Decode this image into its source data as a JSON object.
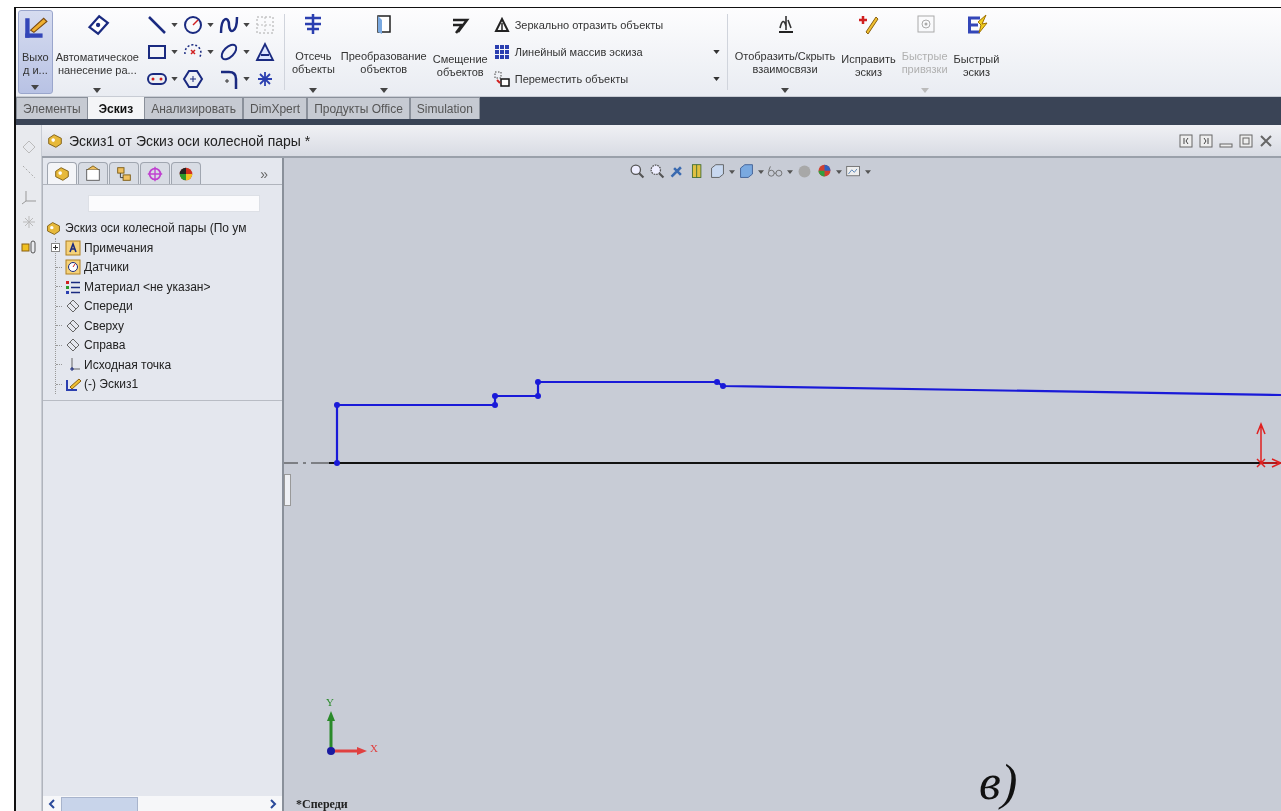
{
  "ribbon": {
    "left_buttons": [
      {
        "label_lines": [
          "Выхо",
          "д и..."
        ],
        "dropdown": true,
        "selected": true
      },
      {
        "label_lines": [
          "Автоматическое",
          "нанесение ра..."
        ],
        "dropdown": true,
        "selected": false
      }
    ],
    "mid_buttons": [
      {
        "label_lines": [
          "Отсечь",
          "объекты"
        ],
        "dropdown": true
      },
      {
        "label_lines": [
          "Преобразование",
          "объектов"
        ],
        "dropdown": true
      },
      {
        "label_lines": [
          "Смещение",
          "объектов"
        ],
        "dropdown": false
      }
    ],
    "small_buttons": [
      {
        "label": "Зеркально отразить объекты",
        "dropdown": false
      },
      {
        "label": "Линейный массив эскиза",
        "dropdown": true
      },
      {
        "label": "Переместить объекты",
        "dropdown": true
      }
    ],
    "right_buttons": [
      {
        "label_lines": [
          "Отобразить/Скрыть",
          "взаимосвязи"
        ],
        "dropdown": true,
        "disabled": false
      },
      {
        "label_lines": [
          "Исправить",
          "эскиз"
        ],
        "dropdown": false,
        "disabled": false
      },
      {
        "label_lines": [
          "Быстрые",
          "привязки"
        ],
        "dropdown": true,
        "disabled": true
      },
      {
        "label_lines": [
          "Быстрый",
          "эскиз"
        ],
        "dropdown": false,
        "disabled": false
      }
    ]
  },
  "tabs": [
    {
      "label": "Элементы",
      "selected": false
    },
    {
      "label": "Эскиз",
      "selected": true
    },
    {
      "label": "Анализировать",
      "selected": false
    },
    {
      "label": "DimXpert",
      "selected": false
    },
    {
      "label": "Продукты Office",
      "selected": false
    },
    {
      "label": "Simulation",
      "selected": false
    }
  ],
  "document": {
    "title": "Эскиз1 от Эскиз оси колесной пары *"
  },
  "feature_tree": {
    "panel_tabs": [
      {
        "selected": true
      },
      {
        "selected": false
      },
      {
        "selected": false
      },
      {
        "selected": false
      },
      {
        "selected": false
      }
    ],
    "more": "»",
    "root": "Эскиз оси колесной пары  (По ум",
    "items": [
      {
        "label": "Примечания",
        "kind": "collapsible"
      },
      {
        "label": "Датчики",
        "kind": "leaf"
      },
      {
        "label": "Материал <не указан>",
        "kind": "leaf"
      },
      {
        "label": "Спереди",
        "kind": "leaf"
      },
      {
        "label": "Сверху",
        "kind": "leaf"
      },
      {
        "label": "Справа",
        "kind": "leaf"
      },
      {
        "label": "Исходная точка",
        "kind": "leaf"
      },
      {
        "label": "(-) Эскиз1",
        "kind": "leaf"
      }
    ]
  },
  "view": {
    "axis_x": "X",
    "axis_y": "Y",
    "view_name": "*Спереди",
    "figure_label": "в)"
  }
}
